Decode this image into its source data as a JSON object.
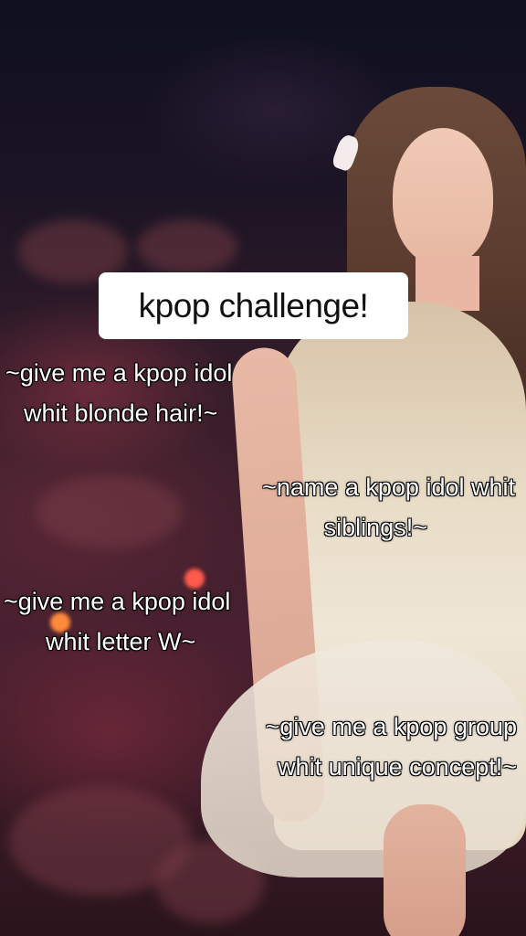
{
  "title": "kpop challenge!",
  "prompts": [
    {
      "line1": "~give me a kpop idol",
      "line2": "whit blonde hair!~"
    },
    {
      "line1": "~name a kpop idol whit",
      "line2": "siblings!~"
    },
    {
      "line1": "~give me a kpop idol",
      "line2": "whit letter W~"
    },
    {
      "line1": "~give me a kpop group",
      "line2": "whit unique concept!~"
    }
  ],
  "colors": {
    "title_bg": "#ffffff",
    "title_text": "#111111",
    "caption_text": "#ffffff",
    "caption_outline": "#000000"
  }
}
